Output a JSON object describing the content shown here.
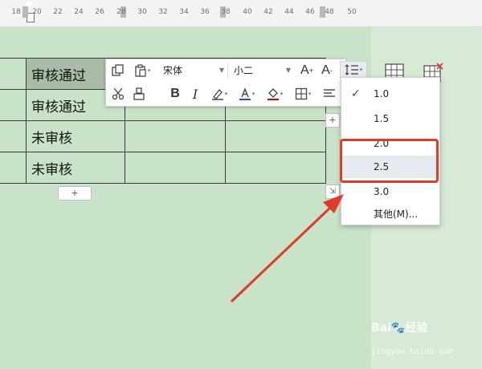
{
  "ruler": {
    "ticks": [
      "18",
      "20",
      "22",
      "24",
      "26",
      "28",
      "30",
      "32",
      "34",
      "36",
      "38",
      "40",
      "42",
      "44",
      "46",
      "48",
      "50"
    ]
  },
  "table": {
    "rows": [
      [
        "",
        "审核通过",
        "",
        ""
      ],
      [
        "",
        "审核通过",
        "",
        ""
      ],
      [
        "",
        "未审核",
        "",
        ""
      ],
      [
        "",
        "未审核",
        "",
        ""
      ]
    ]
  },
  "toolbar": {
    "font_name": "宋体",
    "font_size": "小二"
  },
  "spacing_menu": {
    "items": [
      "1.0",
      "1.5",
      "2.0",
      "2.5",
      "3.0",
      "其他(M)..."
    ],
    "checked": "1.0",
    "highlighted": "2.5"
  },
  "add_symbol": "+",
  "colors": {
    "accent_red": "#e03a2a",
    "underline_red": "#d40000",
    "font_blue": "#1f4fd6",
    "page_green": "#c8e3c7"
  },
  "icons": [
    "copy-icon",
    "paste-icon",
    "cut-icon",
    "format-painter-icon",
    "bold-icon",
    "italic-icon",
    "highlight-icon",
    "font-color-icon",
    "fill-color-icon",
    "border-icon",
    "align-icon",
    "line-spacing-icon",
    "increase-font-icon",
    "decrease-font-icon",
    "insert-table-icon",
    "delete-table-icon"
  ],
  "watermark": {
    "brand": "Bai🐾经验",
    "url": "jingyan.baidu.com"
  }
}
